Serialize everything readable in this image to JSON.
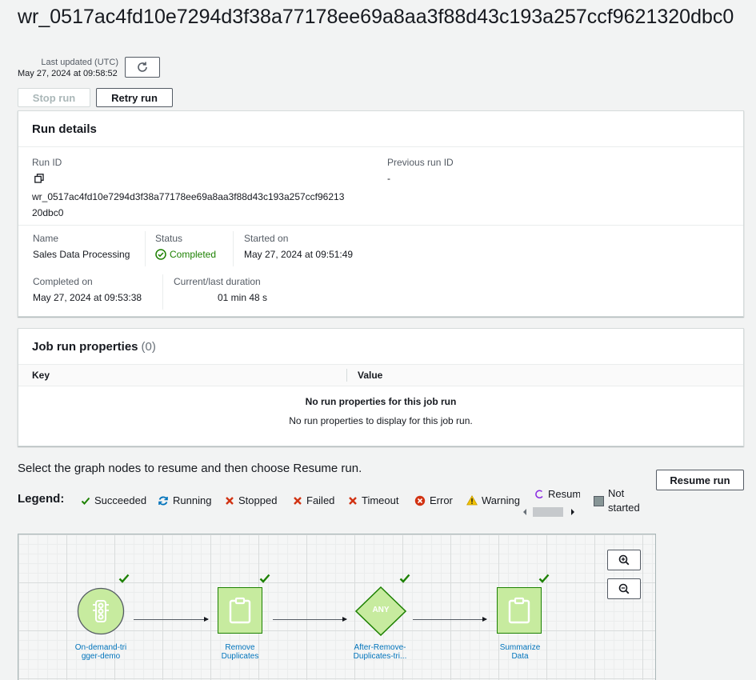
{
  "page": {
    "title": "wr_0517ac4fd10e7294d3f38a77178ee69a8aa3f88d43c193a257ccf9621320dbc0",
    "last_updated_label": "Last updated (UTC)",
    "last_updated_value": "May 27, 2024 at 09:58:52"
  },
  "actions": {
    "stop_run": "Stop run",
    "retry_run": "Retry run",
    "resume_run": "Resume run"
  },
  "run_details": {
    "heading": "Run details",
    "run_id_label": "Run ID",
    "run_id_line1": "wr_0517ac4fd10e7294d3f38a77178ee69a8aa3f88d43c193a257ccf96213",
    "run_id_line2": "20dbc0",
    "previous_run_id_label": "Previous run ID",
    "previous_run_id_value": "-",
    "name_label": "Name",
    "name_value": "Sales Data Processing",
    "status_label": "Status",
    "status_value": "Completed",
    "started_on_label": "Started on",
    "started_on_value": "May 27, 2024 at 09:51:49",
    "completed_on_label": "Completed on",
    "completed_on_value": "May 27, 2024 at 09:53:38",
    "duration_label": "Current/last duration",
    "duration_value": "01 min 48 s"
  },
  "job_run_properties": {
    "heading": "Job run properties",
    "count": "(0)",
    "columns": [
      "Key",
      "Value"
    ],
    "empty_title": "No run properties for this job run",
    "empty_desc": "No run properties to display for this job run."
  },
  "graph": {
    "instruction": "Select the graph nodes to resume and then choose Resume run.",
    "legend_label": "Legend:",
    "legend": {
      "succeeded": "Succeeded",
      "running": "Running",
      "stopped": "Stopped",
      "failed": "Failed",
      "timeout": "Timeout",
      "error": "Error",
      "warning": "Warning",
      "resume": "Resum",
      "not_started_1": "Not",
      "not_started_2": "started"
    },
    "nodes": [
      {
        "label1": "On-demand-tri",
        "label2": "gger-demo"
      },
      {
        "label1": "Remove",
        "label2": "Duplicates"
      },
      {
        "label1": "After-Remove-",
        "label2": "Duplicates-tri..."
      },
      {
        "label1": "Summarize",
        "label2": "Data"
      }
    ],
    "any_label": "ANY"
  },
  "colors": {
    "success_green": "#1d8102",
    "node_fill": "#c7eb9f",
    "node_border": "#1d8102",
    "link_blue": "#0073bb",
    "error_red": "#d13212"
  }
}
